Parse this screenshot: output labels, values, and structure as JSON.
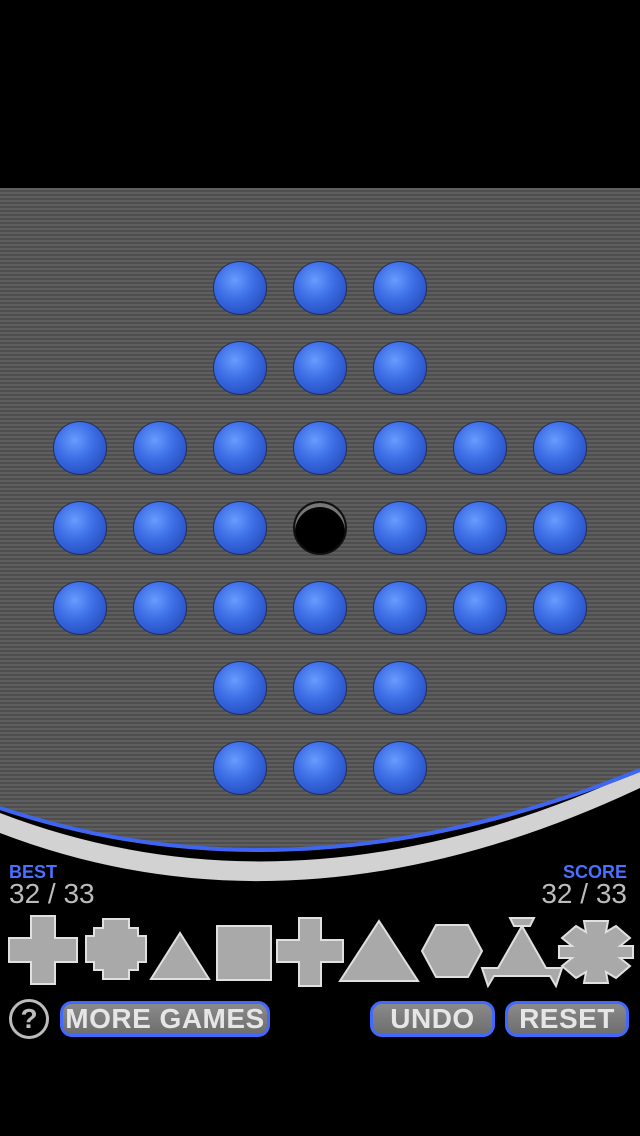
{
  "stats": {
    "best_label": "BEST",
    "best_value": "32 / 33",
    "score_label": "SCORE",
    "score_value": "32 / 33"
  },
  "board": {
    "rows": [
      [
        null,
        null,
        1,
        1,
        1,
        null,
        null
      ],
      [
        null,
        null,
        1,
        1,
        1,
        null,
        null
      ],
      [
        1,
        1,
        1,
        1,
        1,
        1,
        1
      ],
      [
        1,
        1,
        1,
        0,
        1,
        1,
        1
      ],
      [
        1,
        1,
        1,
        1,
        1,
        1,
        1
      ],
      [
        null,
        null,
        1,
        1,
        1,
        null,
        null
      ],
      [
        null,
        null,
        1,
        1,
        1,
        null,
        null
      ]
    ]
  },
  "shapes": [
    "large-cross-icon",
    "octagon-icon",
    "small-triangle-icon",
    "square-icon",
    "thin-cross-icon",
    "large-triangle-icon",
    "hexagon-icon",
    "star-triangle-icon",
    "gear-icon"
  ],
  "buttons": {
    "help": "?",
    "more_games": "MORE GAMES",
    "undo": "UNDO",
    "reset": "RESET"
  },
  "colors": {
    "peg": "#3d6fe6",
    "accent": "#4168ff",
    "board": "#5a5a5a"
  }
}
